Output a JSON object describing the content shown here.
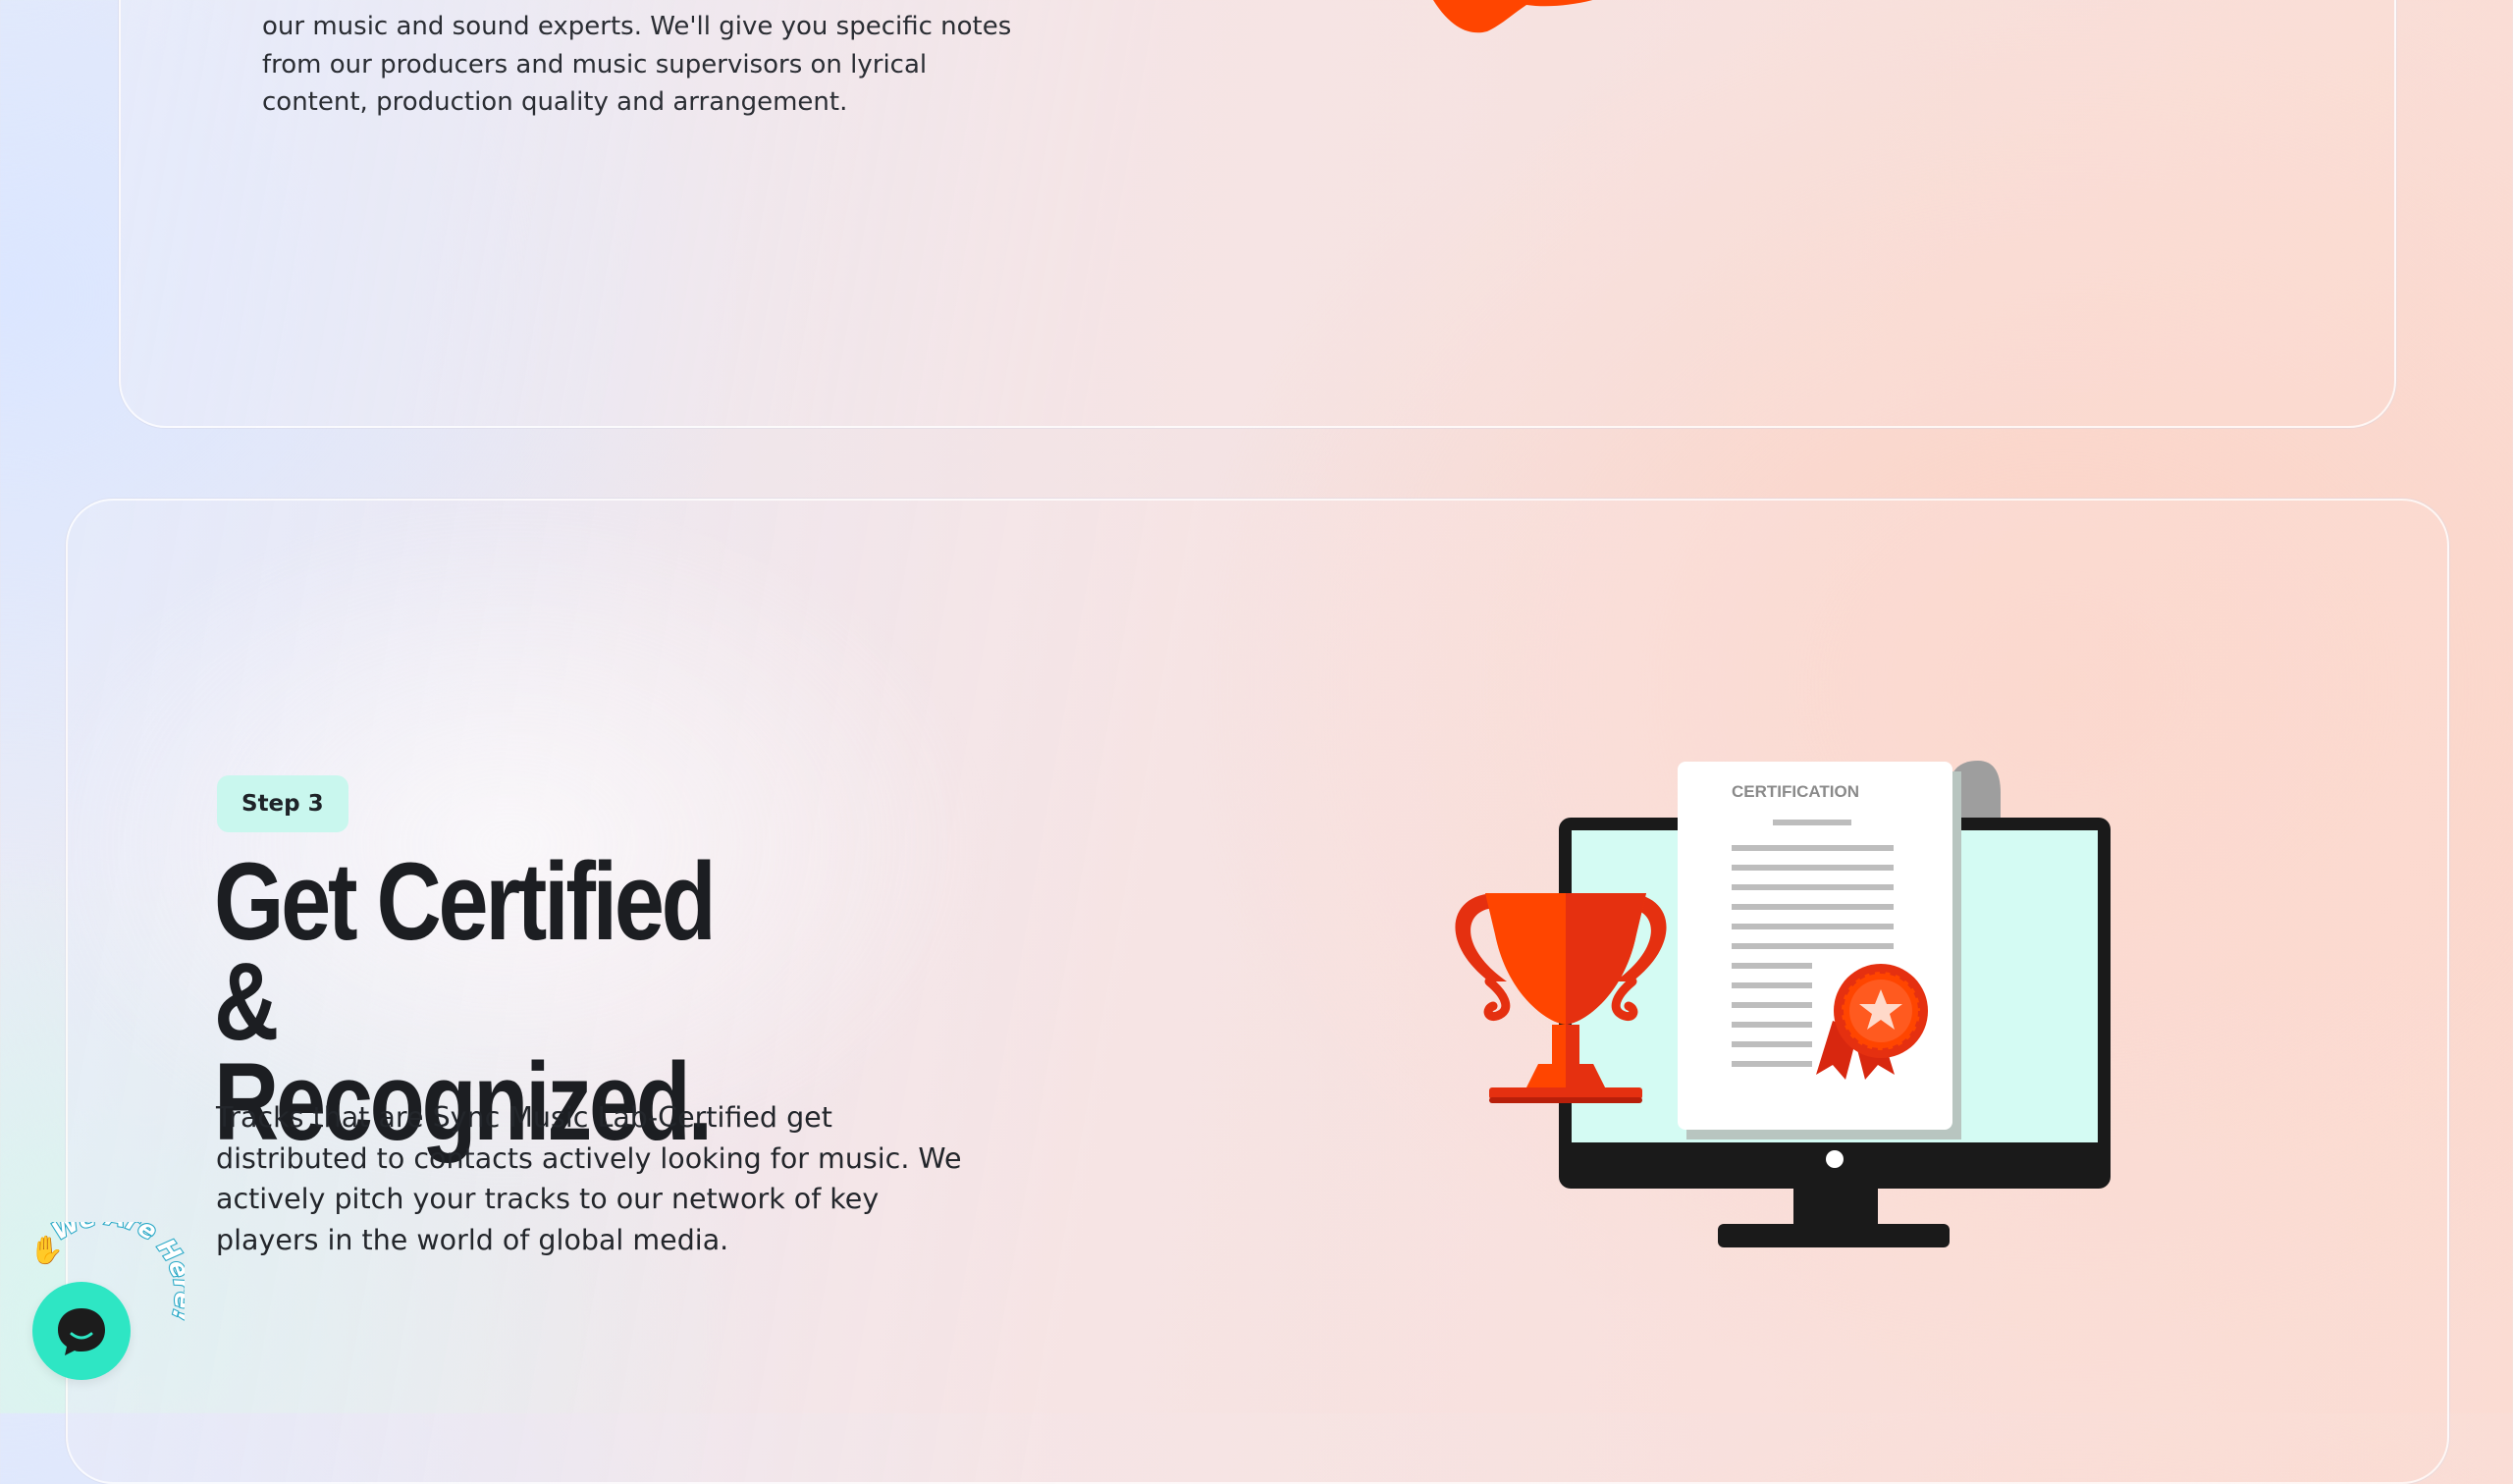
{
  "step2": {
    "description": "our music and sound experts. We'll give you specific notes from our producers and music supervisors on lyrical content, production quality and arrangement."
  },
  "step3": {
    "badge": "Step 3",
    "headline": "Get Certified & Recognized.",
    "description": "Tracks that are Sync Music Lab-Certified get distributed to contacts actively looking for music. We actively pitch your tracks to our network of key players in the world of global media.",
    "illustration": {
      "certificate_title": "CERTIFICATION",
      "icons": [
        "monitor-icon",
        "trophy-icon",
        "certificate-icon",
        "ribbon-medal-icon"
      ]
    }
  },
  "chat_widget": {
    "curved_label": "We Are Here!",
    "wave_emoji": "✋",
    "icon": "chat-bubble-icon"
  },
  "colors": {
    "accent_orange": "#ff4500",
    "accent_red": "#e53010",
    "accent_teal": "#2ee6c4",
    "badge_bg": "#c9f7ee",
    "screen_mint": "#d4fbf3",
    "curved_text": "#2aa9c7"
  }
}
